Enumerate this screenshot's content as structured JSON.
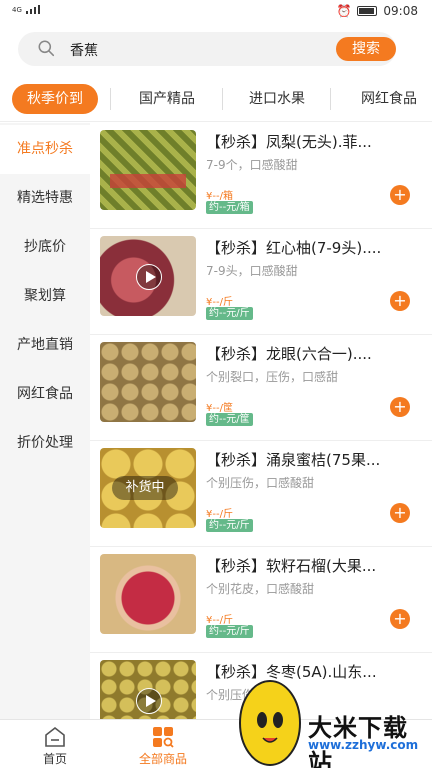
{
  "status_bar": {
    "network": "4G",
    "time": "09:08"
  },
  "search": {
    "value": "香蕉",
    "button_label": "搜索"
  },
  "category_tabs": [
    {
      "label": "秋季价到"
    },
    {
      "label": "国产精品"
    },
    {
      "label": "进口水果"
    },
    {
      "label": "网红食品"
    }
  ],
  "sidebar": {
    "items": [
      {
        "label": "准点秒杀"
      },
      {
        "label": "精选特惠"
      },
      {
        "label": "抄底价"
      },
      {
        "label": "聚划算"
      },
      {
        "label": "产地直销"
      },
      {
        "label": "网红食品"
      },
      {
        "label": "折价处理"
      }
    ]
  },
  "products": [
    {
      "title": "【秒杀】凤梨(无头).菲...",
      "desc": "7-9个，口感酸甜",
      "price": "¥--/箱",
      "unit_price": "约--元/箱",
      "thumb_color": "#8a9a3a"
    },
    {
      "title": "【秒杀】红心柚(7-9头)....",
      "desc": "7-9头，口感酸甜",
      "price": "¥--/斤",
      "unit_price": "约--元/斤",
      "thumb_color": "#b8505a"
    },
    {
      "title": "【秒杀】龙眼(六合一)....",
      "desc": "个别裂口，压伤，口感甜",
      "price": "¥--/筐",
      "unit_price": "约--元/筐",
      "thumb_color": "#b69a60"
    },
    {
      "title": "【秒杀】涌泉蜜桔(75果...",
      "desc": "个别压伤，口感酸甜",
      "price": "¥--/斤",
      "unit_price": "约--元/斤",
      "thumb_color": "#d8b24a",
      "badge": "补货中"
    },
    {
      "title": "【秒杀】软籽石榴(大果...",
      "desc": "个别花皮，口感酸甜",
      "price": "¥--/斤",
      "unit_price": "约--元/斤",
      "thumb_color": "#b03a48"
    },
    {
      "title": "【秒杀】冬枣(5A).山东...",
      "desc": "个别压伤",
      "price": "",
      "unit_price": "",
      "thumb_color": "#b8a040"
    }
  ],
  "tab_bar": {
    "items": [
      {
        "label": "首页"
      },
      {
        "label": "全部商品"
      }
    ]
  },
  "watermark": {
    "text": "大米下载站",
    "url": "www.zzhyw.com"
  },
  "colors": {
    "accent": "#f47a20",
    "unit_badge": "#65b98a"
  }
}
